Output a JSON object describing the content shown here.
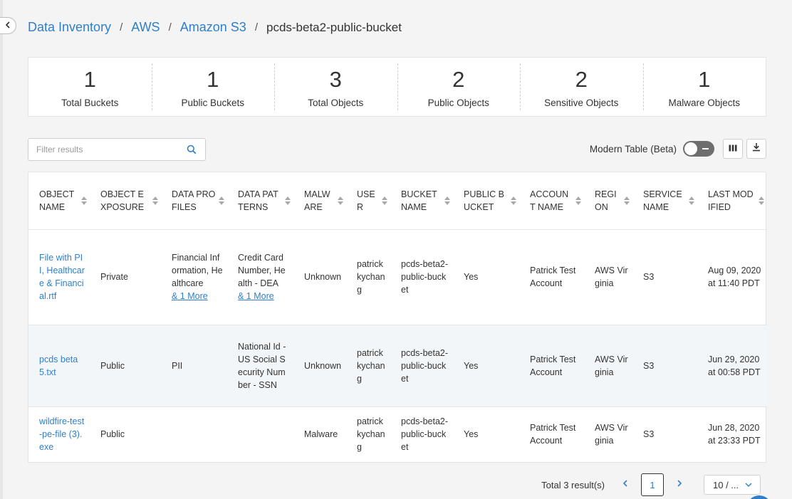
{
  "breadcrumb": {
    "items": [
      "Data Inventory",
      "AWS",
      "Amazon S3"
    ],
    "current": "pcds-beta2-public-bucket",
    "separator": "/"
  },
  "stats": [
    {
      "value": "1",
      "label": "Total Buckets"
    },
    {
      "value": "1",
      "label": "Public Buckets"
    },
    {
      "value": "3",
      "label": "Total Objects"
    },
    {
      "value": "2",
      "label": "Public Objects"
    },
    {
      "value": "2",
      "label": "Sensitive Objects"
    },
    {
      "value": "1",
      "label": "Malware Objects"
    }
  ],
  "filter": {
    "placeholder": "Filter results",
    "icon": "search-icon"
  },
  "toolbar": {
    "modern_table_label": "Modern Table (Beta)",
    "toggle_on": false,
    "columns_icon": "columns-icon",
    "download_icon": "download-icon"
  },
  "table": {
    "columns": [
      "OBJECT NAME",
      "OBJECT EXPOSURE",
      "DATA PROFILES",
      "DATA PATTERNS",
      "MALWARE",
      "USER",
      "BUCKET NAME",
      "PUBLIC BUCKET",
      "ACCOUNT NAME",
      "REGION",
      "SERVICE NAME",
      "LAST MODIFIED"
    ],
    "rows": [
      {
        "object_name": "File with PII, Healthcare & Financial.rtf",
        "exposure": "Private",
        "data_profiles": "Financial Information, Healthcare",
        "data_profiles_more": "& 1 More",
        "data_patterns": "Credit Card Number, Health - DEA",
        "data_patterns_more": "& 1 More",
        "malware": "Unknown",
        "user": "patrick kychang",
        "bucket": "pcds-beta2-public-bucket",
        "public_bucket": "Yes",
        "account": "Patrick Test Account",
        "region": "AWS Virginia",
        "service": "S3",
        "last_modified": "Aug 09, 2020 at 11:40 PDT"
      },
      {
        "object_name": "pcds beta 5.txt",
        "exposure": "Public",
        "data_profiles": "PII",
        "data_patterns": "National Id - US Social Security Number - SSN",
        "malware": "Unknown",
        "user": "patrick kychang",
        "bucket": "pcds-beta2-public-bucket",
        "public_bucket": "Yes",
        "account": "Patrick Test Account",
        "region": "AWS Virginia",
        "service": "S3",
        "last_modified": "Jun 29, 2020 at 00:58 PDT"
      },
      {
        "object_name": "wildfire-test-pe-file (3).exe",
        "exposure": "Public",
        "data_profiles": "",
        "data_patterns": "",
        "malware": "Malware",
        "user": "patrick kychang",
        "bucket": "pcds-beta2-public-bucket",
        "public_bucket": "Yes",
        "account": "Patrick Test Account",
        "region": "AWS Virginia",
        "service": "S3",
        "last_modified": "Jun 28, 2020 at 23:33 PDT"
      }
    ]
  },
  "pagination": {
    "total_text": "Total 3 result(s)",
    "current_page": "1",
    "page_size": "10 / ..."
  },
  "colors": {
    "link": "#2f7fc9",
    "stripe": "#f2f6f9",
    "toggle": "#6e6e6e"
  }
}
